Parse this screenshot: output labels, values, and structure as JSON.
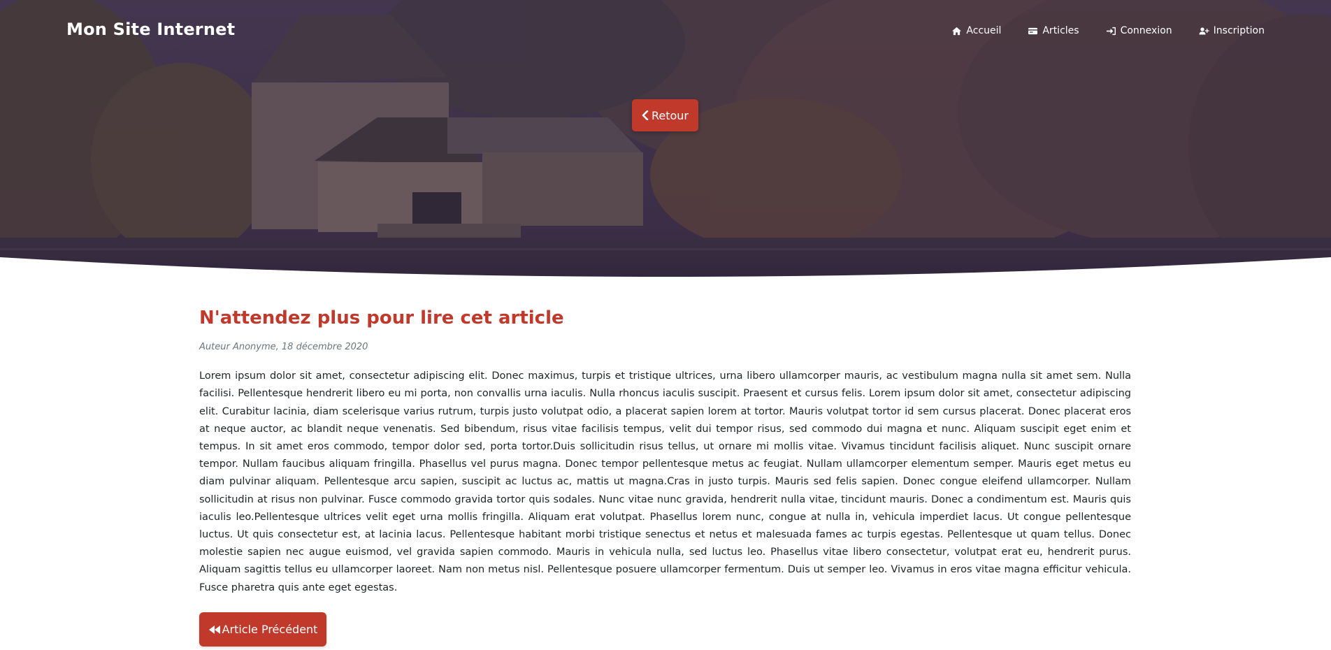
{
  "header": {
    "brand": "Mon Site Internet",
    "nav": [
      {
        "label": "Accueil",
        "icon": "home-icon"
      },
      {
        "label": "Articles",
        "icon": "id-card-icon"
      },
      {
        "label": "Connexion",
        "icon": "sign-in-icon"
      },
      {
        "label": "Inscription",
        "icon": "user-plus-icon"
      }
    ]
  },
  "hero": {
    "back_label": "Retour",
    "back_icon": "chevron-left-icon"
  },
  "article": {
    "title": "N'attendez plus pour lire cet article",
    "meta": "Auteur Anonyme, 18 décembre 2020",
    "body": "Lorem ipsum dolor sit amet, consectetur adipiscing elit. Donec maximus, turpis et tristique ultrices, urna libero ullamcorper mauris, ac vestibulum magna nulla sit amet sem. Nulla facilisi. Pellentesque hendrerit libero eu mi porta, non convallis urna iaculis. Nulla rhoncus iaculis suscipit. Praesent et cursus felis. Lorem ipsum dolor sit amet, consectetur adipiscing elit. Curabitur lacinia, diam scelerisque varius rutrum, turpis justo volutpat odio, a placerat sapien lorem at tortor. Mauris volutpat tortor id sem cursus placerat. Donec placerat eros at neque auctor, ac blandit neque venenatis. Sed bibendum, risus vitae facilisis tempus, velit dui tempor risus, sed commodo dui magna et nunc. Aliquam suscipit eget enim et tempus. In sit amet eros commodo, tempor dolor sed, porta tortor.Duis sollicitudin risus tellus, ut ornare mi mollis vitae. Vivamus tincidunt facilisis aliquet. Nunc suscipit ornare tempor. Nullam faucibus aliquam fringilla. Phasellus vel purus magna. Donec tempor pellentesque metus ac feugiat. Nullam ullamcorper elementum semper. Mauris eget metus eu diam pulvinar aliquam. Pellentesque arcu sapien, suscipit ac luctus ac, mattis ut magna.Cras in justo turpis. Mauris sed felis sapien. Donec congue eleifend ullamcorper. Nullam sollicitudin at risus non pulvinar. Fusce commodo gravida tortor quis sodales. Nunc vitae nunc gravida, hendrerit nulla vitae, tincidunt mauris. Donec a condimentum est. Mauris quis iaculis leo.Pellentesque ultrices velit eget urna mollis fringilla. Aliquam erat volutpat. Phasellus lorem nunc, congue at nulla in, vehicula imperdiet lacus. Ut congue pellentesque luctus. Ut quis consectetur est, at lacinia lacus. Pellentesque habitant morbi tristique senectus et netus et malesuada fames ac turpis egestas. Pellentesque ut quam tellus. Donec molestie sapien nec augue euismod, vel gravida sapien commodo. Mauris in vehicula nulla, sed luctus leo. Phasellus vitae libero consectetur, volutpat erat eu, hendrerit purus. Aliquam sagittis tellus eu ullamcorper laoreet. Nam non metus nisl. Pellentesque posuere ullamcorper fermentum. Duis ut semper leo. Vivamus in eros vitae magna efficitur vehicula. Fusce pharetra quis ante eget egestas.",
    "prev_label": "Article Précédent",
    "prev_icon": "backward-icon"
  },
  "colors": {
    "accent": "#c0392b",
    "hero_overlay": "#3a2a44",
    "text": "#212529",
    "muted": "#6c757d"
  }
}
